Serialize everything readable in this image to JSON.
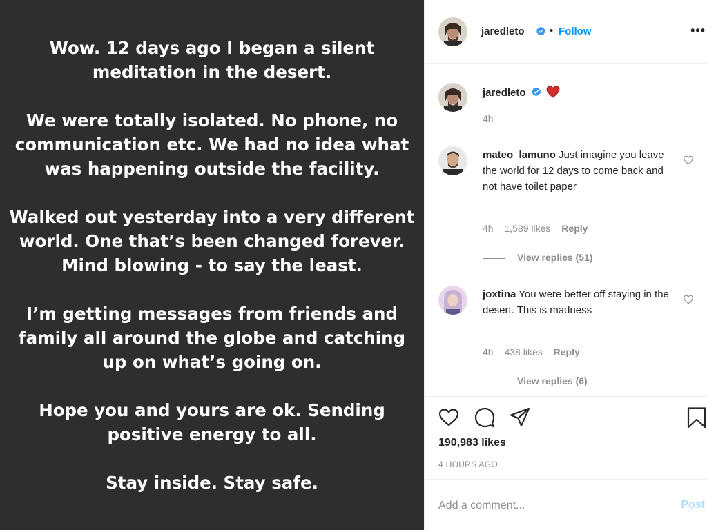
{
  "post": {
    "paragraphs": [
      "Wow. 12 days ago I began a silent\nmeditation in the desert.",
      "We were totally isolated. No phone, no\ncommunication etc. We had no idea what\nwas happening outside the facility.",
      "Walked out yesterday into a very different\nworld. One that’s been changed forever.\nMind blowing - to say the least.",
      "I’m getting messages from friends and\nfamily all around the globe and catching\nup on what’s going on.",
      "Hope you and yours are ok. Sending\npositive energy to all.",
      "Stay inside. Stay safe."
    ]
  },
  "header": {
    "username": "jaredleto",
    "dot": "•",
    "follow_label": "Follow",
    "more_label": "•••"
  },
  "caption": {
    "username": "jaredleto",
    "emoji": "❤️",
    "time": "4h"
  },
  "comments": [
    {
      "username": "mateo_lamuno",
      "text": "Just imagine you leave the world for 12 days to come back and not have toilet paper",
      "time": "4h",
      "likes": "1,589 likes",
      "reply_label": "Reply",
      "view_replies": "View replies (51)"
    },
    {
      "username": "joxtina",
      "text": "You were better off staying in the desert. This is madness",
      "time": "4h",
      "likes": "438 likes",
      "reply_label": "Reply",
      "view_replies": "View replies (6)"
    }
  ],
  "footer": {
    "likes": "190,983 likes",
    "time": "4 HOURS AGO",
    "comment_placeholder": "Add a comment...",
    "post_label": "Post"
  },
  "colors": {
    "accent": "#0095f6",
    "post_disabled": "#b2dffc",
    "image_bg": "#2e2e2e",
    "verified": "#3897f0",
    "emoji_heart": "#d62c2c"
  }
}
